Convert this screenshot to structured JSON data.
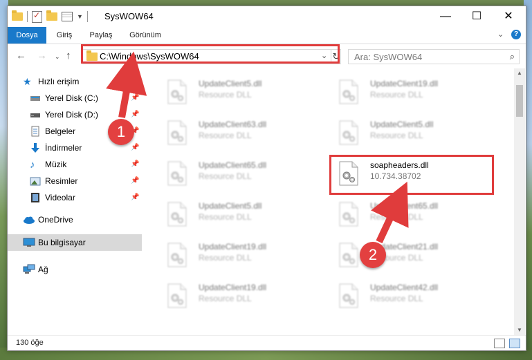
{
  "window": {
    "title": "SysWOW64"
  },
  "ribbon": {
    "tabs": [
      {
        "label": "Dosya",
        "active": true
      },
      {
        "label": "Giriş",
        "active": false
      },
      {
        "label": "Paylaş",
        "active": false
      },
      {
        "label": "Görünüm",
        "active": false
      }
    ],
    "help_label": "?"
  },
  "navigation": {
    "address": "C:\\Windows\\SysWOW64",
    "search_placeholder": "Ara: SysWOW64"
  },
  "sidebar": {
    "quick_access": "Hızlı erişim",
    "items": [
      {
        "label": "Yerel Disk (C:)",
        "icon": "drive-icon"
      },
      {
        "label": "Yerel Disk (D:)",
        "icon": "drive-icon"
      },
      {
        "label": "Belgeler",
        "icon": "documents-icon"
      },
      {
        "label": "İndirmeler",
        "icon": "downloads-icon"
      },
      {
        "label": "Müzik",
        "icon": "music-icon"
      },
      {
        "label": "Resimler",
        "icon": "pictures-icon"
      },
      {
        "label": "Videolar",
        "icon": "videos-icon"
      }
    ],
    "onedrive": "OneDrive",
    "this_pc": "Bu bilgisayar",
    "network": "Ağ"
  },
  "files": {
    "left": [
      {
        "name": "UpdateClient5.dll",
        "desc": "Resource DLL"
      },
      {
        "name": "UpdateClient63.dll",
        "desc": "Resource DLL"
      },
      {
        "name": "UpdateClient65.dll",
        "desc": "Resource DLL"
      },
      {
        "name": "UpdateClient5.dll",
        "desc": "Resource DLL"
      },
      {
        "name": "UpdateClient19.dll",
        "desc": "Resource DLL"
      },
      {
        "name": "UpdateClient19.dll",
        "desc": "Resource DLL"
      }
    ],
    "right": [
      {
        "name": "UpdateClient19.dll",
        "desc": "Resource DLL"
      },
      {
        "name": "UpdateClient5.dll",
        "desc": "Resource DLL"
      },
      {
        "name": "soapheaders.dll",
        "desc": "10.734.38702"
      },
      {
        "name": "UpdateClient65.dll",
        "desc": "Resource DLL"
      },
      {
        "name": "UpdateClient21.dll",
        "desc": "Resource DLL"
      },
      {
        "name": "UpdateClient42.dll",
        "desc": "Resource DLL"
      }
    ]
  },
  "status": {
    "count": "130 öğe"
  },
  "annotations": {
    "step1": "1",
    "step2": "2",
    "color": "#e03c3c"
  }
}
